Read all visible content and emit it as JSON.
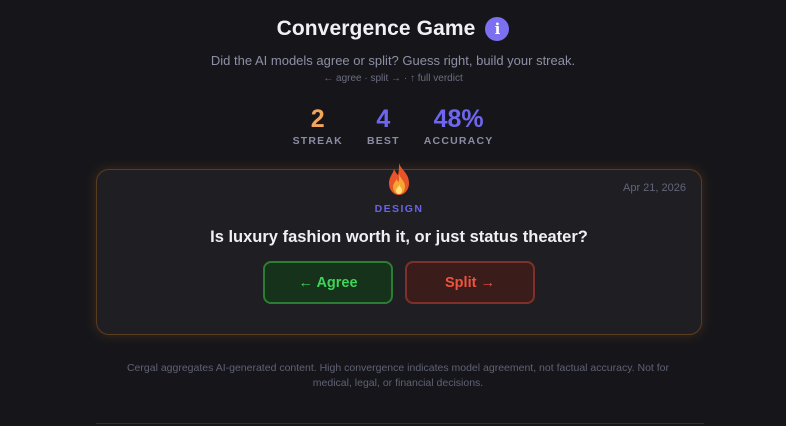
{
  "header": {
    "title": "Convergence Game",
    "info_icon": "info-icon",
    "subtitle": "Did the AI models agree or split? Guess right, build your streak.",
    "hints": "← agree · split → · ↑ full verdict"
  },
  "stats": [
    {
      "value": "2",
      "label": "STREAK",
      "color": "#f2a55a"
    },
    {
      "value": "4",
      "label": "BEST",
      "color": "#6e66f0"
    },
    {
      "value": "48%",
      "label": "ACCURACY",
      "color": "#6e66f0"
    }
  ],
  "card": {
    "icon": "fire-icon",
    "date": "Apr 21, 2026",
    "category": "DESIGN",
    "question": "Is luxury fashion worth it, or just status theater?",
    "agree_label": "← Agree",
    "split_label": "Split →"
  },
  "disclaimer": "Cergal aggregates AI-generated content. High convergence indicates model agreement, not factual accuracy. Not for medical, legal, or financial decisions.",
  "colors": {
    "background": "#16161a",
    "accent": "#7c6ff0",
    "agree": "#3ed45a",
    "split": "#f0533e",
    "card_glow": "#d67828"
  }
}
